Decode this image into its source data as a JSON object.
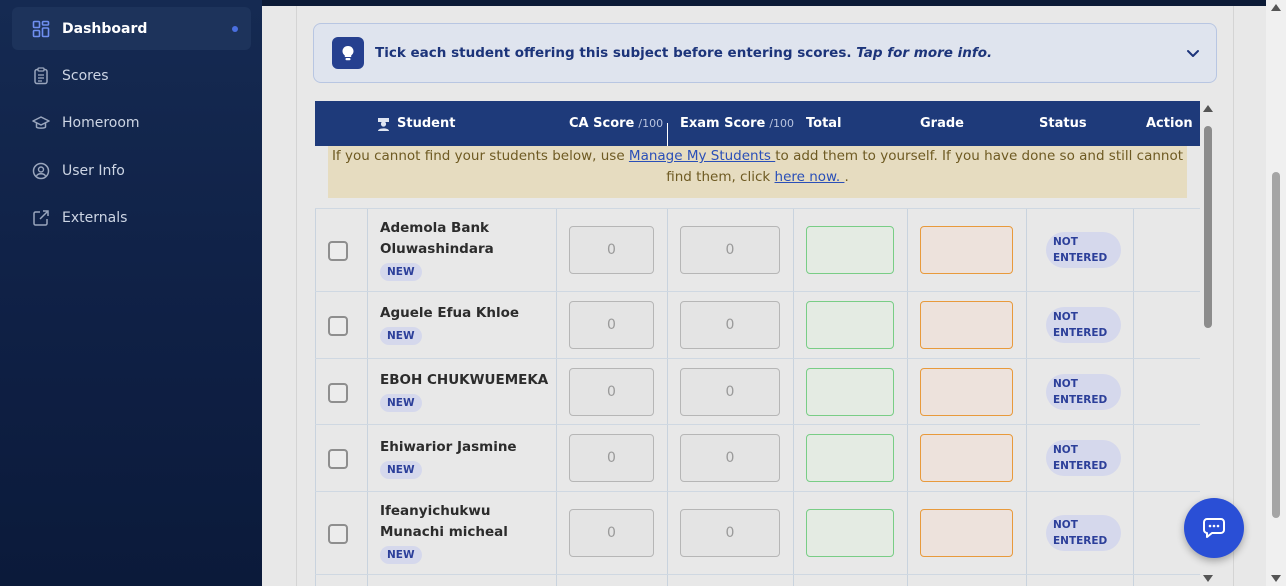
{
  "sidebar": {
    "items": [
      {
        "label": "Dashboard",
        "icon": "dashboard-icon",
        "active": true
      },
      {
        "label": "Scores",
        "icon": "clipboard-icon"
      },
      {
        "label": "Homeroom",
        "icon": "graduation-cap-icon"
      },
      {
        "label": "User Info",
        "icon": "user-circle-icon"
      },
      {
        "label": "Externals",
        "icon": "external-link-icon"
      }
    ]
  },
  "info_banner": {
    "text": "Tick each student offering this subject before entering scores.",
    "link_text": "Tap for more info."
  },
  "table": {
    "headers": {
      "student": "Student",
      "ca_score": "CA Score",
      "ca_max": "/100",
      "exam_score": "Exam Score",
      "exam_max": "/100",
      "total": "Total",
      "grade": "Grade",
      "status": "Status",
      "action": "Action"
    },
    "notice": {
      "part1": "If you cannot find your students below, use ",
      "link1": "Manage My Students ",
      "part2": "to add them to yourself. If you have done so and still cannot find them, click ",
      "link2": "here now. ",
      "part3": "."
    },
    "rows": [
      {
        "name": "Ademola Bank Oluwashindara",
        "badge": "NEW",
        "ca": "0",
        "exam": "0",
        "status": "NOT ENTERED"
      },
      {
        "name": "Aguele Efua Khloe",
        "badge": "NEW",
        "ca": "0",
        "exam": "0",
        "status": "NOT ENTERED"
      },
      {
        "name": "EBOH CHUKWUEMEKA",
        "badge": "NEW",
        "ca": "0",
        "exam": "0",
        "status": "NOT ENTERED"
      },
      {
        "name": "Ehiwarior Jasmine",
        "badge": "NEW",
        "ca": "0",
        "exam": "0",
        "status": "NOT ENTERED"
      },
      {
        "name": "Ifeanyichukwu Munachi micheal",
        "badge": "NEW",
        "ca": "0",
        "exam": "0",
        "status": "NOT ENTERED"
      }
    ]
  },
  "colors": {
    "sidebar_bg": "#0f2045",
    "header_bg": "#1e3a7a",
    "accent": "#2a4fd6",
    "notice_bg": "#e6dcc0"
  }
}
